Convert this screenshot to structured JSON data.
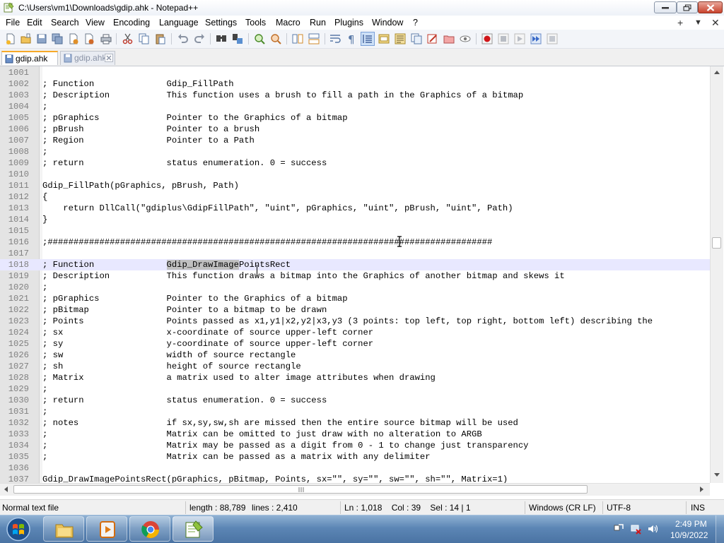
{
  "window": {
    "title": "C:\\Users\\vm1\\Downloads\\gdip.ahk - Notepad++"
  },
  "menu": {
    "items": [
      "File",
      "Edit",
      "Search",
      "View",
      "Encoding",
      "Language",
      "Settings",
      "Tools",
      "Macro",
      "Run",
      "Plugins",
      "Window",
      "?"
    ],
    "right": [
      "+",
      "▼",
      "✕"
    ]
  },
  "toolbar": {
    "icons": [
      "new-file-icon",
      "open-file-icon",
      "save-icon",
      "save-all-icon",
      "close-icon",
      "close-all-icon",
      "print-icon",
      "cut-icon",
      "copy-icon",
      "paste-icon",
      "undo-icon",
      "redo-icon",
      "find-icon",
      "replace-icon",
      "zoom-in-icon",
      "zoom-out-icon",
      "sync-vertical-icon",
      "sync-horizontal-icon",
      "word-wrap-icon",
      "show-all-chars-icon",
      "indent-guide-icon",
      "user-language-icon",
      "doc-map-icon",
      "function-list-icon",
      "folder-workspace-icon",
      "monitor-icon",
      "record-macro-icon",
      "stop-macro-icon",
      "play-macro-icon",
      "run-macro-multiple-icon",
      "save-macro-icon"
    ]
  },
  "tabs": [
    {
      "label": "gdip.ahk",
      "active": true
    },
    {
      "label": "gdip.ahk",
      "active": false
    }
  ],
  "editor": {
    "lines": [
      {
        "n": "1001",
        "text": ""
      },
      {
        "n": "1002",
        "text": "; Function              Gdip_FillPath"
      },
      {
        "n": "1003",
        "text": "; Description           This function uses a brush to fill a path in the Graphics of a bitmap"
      },
      {
        "n": "1004",
        "text": ";"
      },
      {
        "n": "1005",
        "text": "; pGraphics             Pointer to the Graphics of a bitmap"
      },
      {
        "n": "1006",
        "text": "; pBrush                Pointer to a brush"
      },
      {
        "n": "1007",
        "text": "; Region                Pointer to a Path"
      },
      {
        "n": "1008",
        "text": ";"
      },
      {
        "n": "1009",
        "text": "; return                status enumeration. 0 = success"
      },
      {
        "n": "1010",
        "text": ""
      },
      {
        "n": "1011",
        "text": "Gdip_FillPath(pGraphics, pBrush, Path)"
      },
      {
        "n": "1012",
        "text": "{"
      },
      {
        "n": "1013",
        "text": "    return DllCall(\"gdiplus\\GdipFillPath\", \"uint\", pGraphics, \"uint\", pBrush, \"uint\", Path)"
      },
      {
        "n": "1014",
        "text": "}"
      },
      {
        "n": "1015",
        "text": ""
      },
      {
        "n": "1016",
        "text": ";######################################################################################"
      },
      {
        "n": "1017",
        "text": ""
      },
      {
        "n": "1018",
        "text": "; Function              ",
        "hl": "Gdip_DrawImage",
        "rest": "PointsRect",
        "current": true
      },
      {
        "n": "1019",
        "text": "; Description           This function draws a bitmap into the Graphics of another bitmap and skews it"
      },
      {
        "n": "1020",
        "text": ";"
      },
      {
        "n": "1021",
        "text": "; pGraphics             Pointer to the Graphics of a bitmap"
      },
      {
        "n": "1022",
        "text": "; pBitmap               Pointer to a bitmap to be drawn"
      },
      {
        "n": "1023",
        "text": "; Points                Points passed as x1,y1|x2,y2|x3,y3 (3 points: top left, top right, bottom left) describing the"
      },
      {
        "n": "1024",
        "text": "; sx                    x-coordinate of source upper-left corner"
      },
      {
        "n": "1025",
        "text": "; sy                    y-coordinate of source upper-left corner"
      },
      {
        "n": "1026",
        "text": "; sw                    width of source rectangle"
      },
      {
        "n": "1027",
        "text": "; sh                    height of source rectangle"
      },
      {
        "n": "1028",
        "text": "; Matrix                a matrix used to alter image attributes when drawing"
      },
      {
        "n": "1029",
        "text": ";"
      },
      {
        "n": "1030",
        "text": "; return                status enumeration. 0 = success"
      },
      {
        "n": "1031",
        "text": ";"
      },
      {
        "n": "1032",
        "text": "; notes                 if sx,sy,sw,sh are missed then the entire source bitmap will be used"
      },
      {
        "n": "1033",
        "text": ";                       Matrix can be omitted to just draw with no alteration to ARGB"
      },
      {
        "n": "1034",
        "text": ";                       Matrix may be passed as a digit from 0 - 1 to change just transparency"
      },
      {
        "n": "1035",
        "text": ";                       Matrix can be passed as a matrix with any delimiter"
      },
      {
        "n": "1036",
        "text": ""
      },
      {
        "n": "1037",
        "text": "Gdip_DrawImagePointsRect(pGraphics, pBitmap, Points, sx=\"\", sy=\"\", sw=\"\", sh=\"\", Matrix=1)"
      }
    ]
  },
  "status": {
    "file_type": "Normal text file",
    "length": "length : 88,789",
    "lines": "lines : 2,410",
    "position": "Ln : 1,018    Col : 39    Sel : 14 | 1",
    "eol": "Windows (CR LF)",
    "encoding": "UTF-8",
    "mode": "INS"
  },
  "taskbar": {
    "apps": [
      "explorer-icon",
      "media-player-icon",
      "chrome-icon",
      "notepadpp-icon"
    ],
    "tray_icons": [
      "action-center-icon",
      "network-icon",
      "volume-icon"
    ],
    "time": "2:49 PM",
    "date": "10/9/2022"
  },
  "colors": {
    "current_line": "#e8e8ff",
    "selection_highlight": "#c0c0c0",
    "gutter": "#e4e4e4",
    "active_tab_accent": "#f7a928"
  }
}
